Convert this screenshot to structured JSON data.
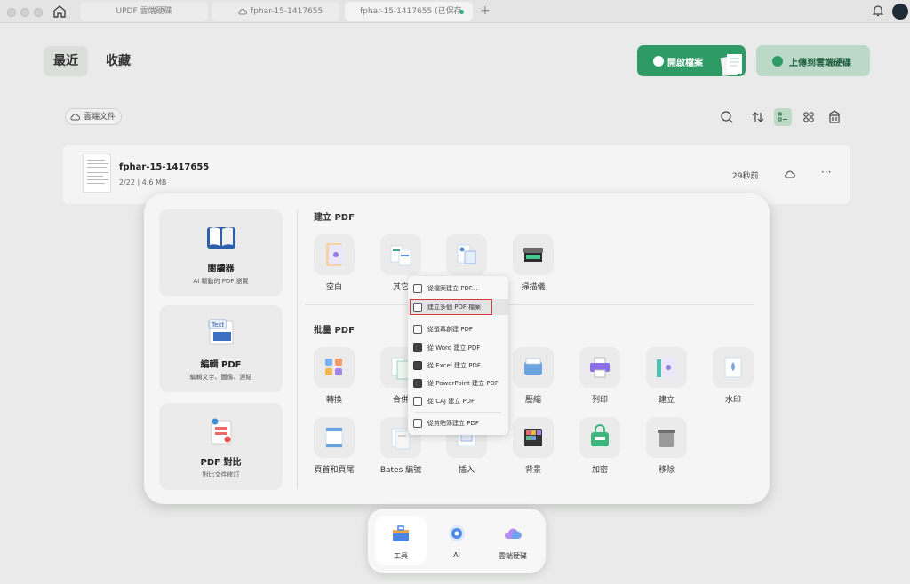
{
  "tabs": [
    {
      "label": "UPDF 雲端硬碟"
    },
    {
      "label": "fphar-15-1417655"
    },
    {
      "label": "fphar-15-1417655 (已保存"
    }
  ],
  "header": {
    "recent": "最近",
    "favorites": "收藏",
    "open_file": "開啟檔案",
    "upload": "上傳到雲端硬碟"
  },
  "cloud_chip": "雲端文件",
  "file": {
    "name": "fphar-15-1417655",
    "meta": "2/22  |  4.6 MB",
    "time": "29秒前",
    "more": "···"
  },
  "left_cards": [
    {
      "title": "閱讀器",
      "sub": "AI 驅動的 PDF 瀏覽",
      "icon": "book-icon"
    },
    {
      "title": "編輯 PDF",
      "sub": "編輯文字、圖像、連結",
      "icon": "edit-text-icon",
      "badge": "Text"
    },
    {
      "title": "PDF 對比",
      "sub": "對比文件修訂",
      "icon": "compare-icon"
    }
  ],
  "sections": {
    "create": "建立 PDF",
    "batch": "批量 PDF"
  },
  "create_tools": [
    {
      "label": "空白",
      "icon": "blank-doc-icon"
    },
    {
      "label": "其它",
      "icon": "other-files-icon"
    },
    {
      "label": "",
      "icon": "image-doc-icon"
    },
    {
      "label": "掃描儀",
      "icon": "scanner-icon"
    }
  ],
  "batch_row1": [
    {
      "label": "轉換",
      "icon": "convert-icon"
    },
    {
      "label": "合併",
      "icon": "merge-icon"
    },
    {
      "label": "壓縮",
      "icon": "compress-icon"
    },
    {
      "label": "列印",
      "icon": "printer-icon"
    },
    {
      "label": "建立",
      "icon": "create-batch-icon"
    },
    {
      "label": "水印",
      "icon": "watermark-icon"
    }
  ],
  "batch_row2": [
    {
      "label": "頁首和頁尾",
      "icon": "header-footer-icon"
    },
    {
      "label": "Bates 編號",
      "icon": "bates-icon"
    },
    {
      "label": "插入",
      "icon": "insert-icon"
    },
    {
      "label": "背景",
      "icon": "background-icon"
    },
    {
      "label": "加密",
      "icon": "encrypt-icon"
    },
    {
      "label": "移除",
      "icon": "trash-icon"
    }
  ],
  "menu": [
    {
      "label": "從檔案建立 PDF...",
      "icon": "folder-icon"
    },
    {
      "label": "建立多個 PDF 檔案",
      "icon": "multi-pdf-icon",
      "highlighted": true
    },
    {
      "label": "從螢幕創建 PDF",
      "icon": "screen-capture-icon"
    },
    {
      "label": "從 Word 建立 PDF",
      "icon": "word-icon"
    },
    {
      "label": "從 Excel 建立 PDF",
      "icon": "excel-icon"
    },
    {
      "label": "從 PowerPoint 建立 PDF",
      "icon": "powerpoint-icon"
    },
    {
      "label": "從 CAJ 建立 PDF",
      "icon": "caj-icon"
    },
    {
      "label": "從剪貼簿建立 PDF",
      "icon": "clipboard-icon"
    }
  ],
  "dock": [
    {
      "label": "工具",
      "icon": "toolbox-icon",
      "active": true
    },
    {
      "label": "AI",
      "icon": "ai-icon"
    },
    {
      "label": "雲端硬碟",
      "icon": "cloud-drive-icon"
    }
  ],
  "colors": {
    "accent_green": "#2e9b67",
    "upload_bg": "#bcd9c8",
    "highlight_border": "#d43a3a"
  }
}
